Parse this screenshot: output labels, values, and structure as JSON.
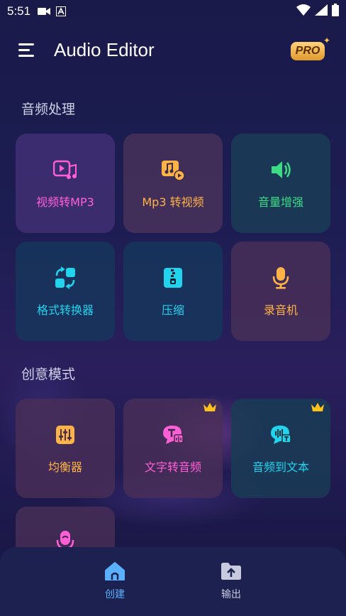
{
  "status_bar": {
    "time": "5:51"
  },
  "header": {
    "title": "Audio Editor",
    "pro_badge": "PRO"
  },
  "sections": [
    {
      "title": "音频处理",
      "cards": [
        {
          "label": "视频转MP3",
          "icon": "video-music-icon",
          "color": "#ff5fd6"
        },
        {
          "label": "Mp3 转视频",
          "icon": "music-video-icon",
          "color": "#ffb347"
        },
        {
          "label": "音量增强",
          "icon": "speaker-icon",
          "color": "#3ddc84"
        },
        {
          "label": "格式转换器",
          "icon": "convert-icon",
          "color": "#22d3ee"
        },
        {
          "label": "压缩",
          "icon": "zip-icon",
          "color": "#22d3ee"
        },
        {
          "label": "录音机",
          "icon": "microphone-icon",
          "color": "#ffb347"
        }
      ]
    },
    {
      "title": "创意模式",
      "cards": [
        {
          "label": "均衡器",
          "icon": "equalizer-icon",
          "color": "#ffb347",
          "premium": false
        },
        {
          "label": "文字转音频",
          "icon": "text-to-speech-icon",
          "color": "#ff5fd6",
          "premium": true
        },
        {
          "label": "音频到文本",
          "icon": "speech-to-text-icon",
          "color": "#22d3ee",
          "premium": true
        },
        {
          "label": "",
          "icon": "voice-changer-icon",
          "color": "#ff5fd6",
          "premium": false
        }
      ]
    }
  ],
  "bottom_nav": [
    {
      "label": "创建",
      "icon": "home-icon",
      "active": true,
      "color": "#5ab0ff"
    },
    {
      "label": "输出",
      "icon": "folder-upload-icon",
      "active": false,
      "color": "#c8cbe0"
    }
  ]
}
